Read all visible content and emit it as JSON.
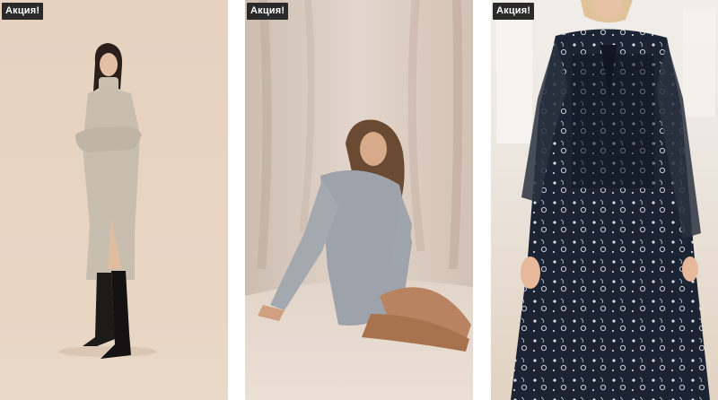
{
  "products": [
    {
      "badge": "Акция!",
      "image_desc": "knit-turtleneck-dress-beige"
    },
    {
      "badge": "Акция!",
      "image_desc": "grey-sweater-dress"
    },
    {
      "badge": "Акция!",
      "image_desc": "navy-printed-chiffon-dress"
    }
  ],
  "colors": {
    "badge_bg": "#2a2a2a",
    "badge_text": "#ffffff"
  }
}
